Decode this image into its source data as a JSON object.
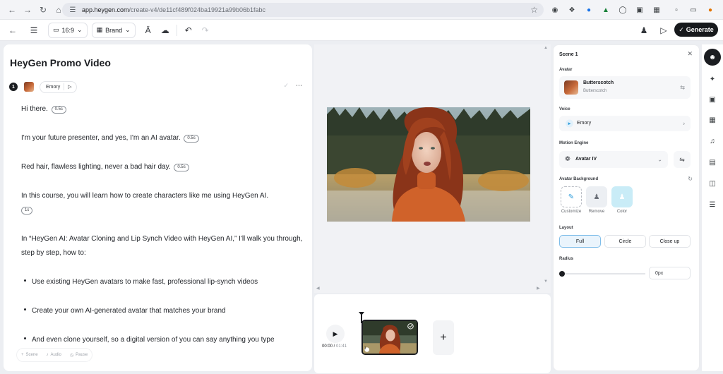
{
  "browser": {
    "url_host": "app.heygen.com",
    "url_path": "/create-v4/de11cf489f024ba19921a99b06b1fabc"
  },
  "toolbar": {
    "aspect_ratio": "16:9",
    "brand_label": "Brand",
    "generate_label": "Generate"
  },
  "script": {
    "title": "HeyGen Promo Video",
    "scene_number": "1",
    "voice_name": "Emory",
    "paragraphs": [
      {
        "text": "Hi there.",
        "pause": "0.5s"
      },
      {
        "text": "I'm your future presenter, and yes, I'm an AI avatar.",
        "pause": "0.5s"
      },
      {
        "text": "Red hair, flawless lighting, never a bad hair day.",
        "pause": "0.5s"
      },
      {
        "text": "In this course, you will learn how to create characters like me using HeyGen AI.",
        "pause": "1s"
      },
      {
        "text": "In “HeyGen AI: Avatar Cloning and Lip Synch Video with HeyGen AI,” I'll walk you through, step by step, how to:"
      }
    ],
    "bullets": [
      "Use existing HeyGen avatars to make fast, professional lip-synch videos",
      "Create your own AI-generated avatar that matches your brand",
      "And even clone yourself, so a digital version of you can say anything you type"
    ],
    "footer": {
      "scene": "Scene",
      "audio": "Audio",
      "pause": "Pause"
    }
  },
  "timeline": {
    "current_time": "00:00",
    "total_time": "01:41",
    "clip_number": "1"
  },
  "properties": {
    "title": "Scene 1",
    "avatar_section": "Avatar",
    "avatar_name": "Butterscotch",
    "avatar_sub": "Butterscotch",
    "voice_section": "Voice",
    "voice_name": "Emory",
    "motion_section": "Motion Engine",
    "motion_value": "Avatar IV",
    "background_section": "Avatar Background",
    "background_options": [
      "Customize",
      "Remove",
      "Color"
    ],
    "layout_section": "Layout",
    "layout_options": [
      "Full",
      "Circle",
      "Close up"
    ],
    "layout_selected": "Full",
    "radius_section": "Radius",
    "radius_value": "0px",
    "radius_level": 0
  },
  "colors": {
    "accent": "#2d9cdb",
    "dark": "#17191c",
    "selected_layout_bg": "#eaf4fc"
  }
}
